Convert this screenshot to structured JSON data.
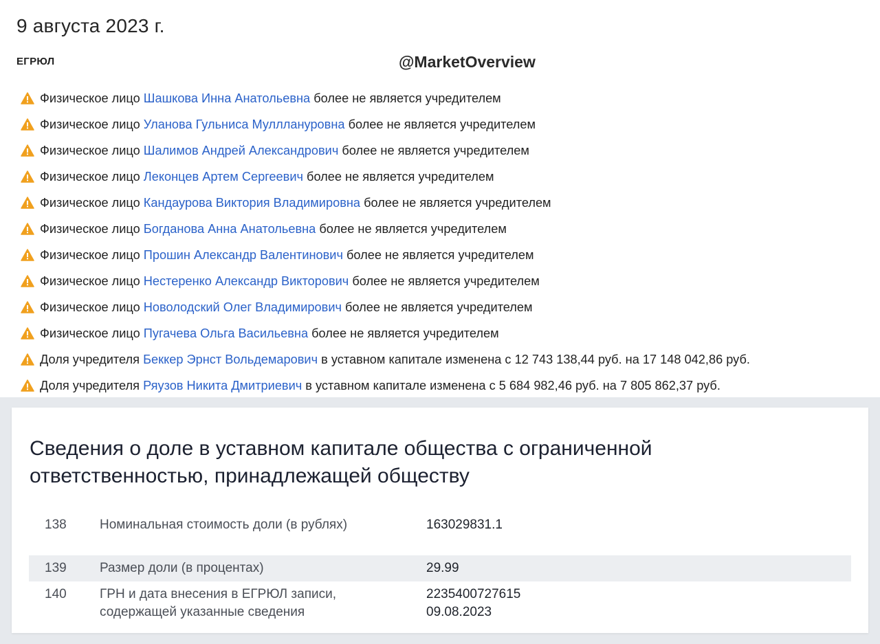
{
  "header": {
    "date": "9 августа 2023 г.",
    "section_label": "ЕГРЮЛ",
    "watermark": "@MarketOverview"
  },
  "events": [
    {
      "prefix": "Физическое лицо",
      "name": "Шашкова Инна Анатольевна",
      "suffix": "более не является учредителем"
    },
    {
      "prefix": "Физическое лицо",
      "name": "Уланова Гульниса Мулллануровна",
      "suffix": "более не является учредителем"
    },
    {
      "prefix": "Физическое лицо",
      "name": "Шалимов Андрей Александрович",
      "suffix": "более не является учредителем"
    },
    {
      "prefix": "Физическое лицо",
      "name": "Леконцев Артем Сергеевич",
      "suffix": "более не является учредителем"
    },
    {
      "prefix": "Физическое лицо",
      "name": "Кандаурова Виктория Владимировна",
      "suffix": "более не является учредителем"
    },
    {
      "prefix": "Физическое лицо",
      "name": "Богданова Анна Анатольевна",
      "suffix": "более не является учредителем"
    },
    {
      "prefix": "Физическое лицо",
      "name": "Прошин Александр Валентинович",
      "suffix": "более не является учредителем"
    },
    {
      "prefix": "Физическое лицо",
      "name": "Нестеренко Александр Викторович",
      "suffix": "более не является учредителем"
    },
    {
      "prefix": "Физическое лицо",
      "name": "Новолодский Олег Владимирович",
      "suffix": "более не является учредителем"
    },
    {
      "prefix": "Физическое лицо",
      "name": "Пугачева Ольга Васильевна",
      "suffix": "более не является учредителем"
    },
    {
      "prefix": "Доля учредителя",
      "name": "Беккер Эрнст Вольдемарович",
      "suffix": "в уставном капитале изменена с 12 743 138,44 руб. на 17 148 042,86 руб."
    },
    {
      "prefix": "Доля учредителя",
      "name": "Ряузов Никита Дмитриевич",
      "suffix": "в уставном капитале изменена с 5 684 982,46 руб. на 7 805 862,37 руб."
    }
  ],
  "card": {
    "title": "Сведения о доле в уставном капитале общества с ограниченной ответственностью, принадлежащей обществу",
    "rows": [
      {
        "num": "138",
        "name": "Номинальная стоимость доли (в рублях)",
        "value_lines": [
          "163029831.1"
        ]
      },
      {
        "num": "139",
        "name": "Размер доли (в процентах)",
        "value_lines": [
          "29.99"
        ]
      },
      {
        "num": "140",
        "name": "ГРН и дата внесения в ЕГРЮЛ записи, содержащей указанные сведения",
        "value_lines": [
          "2235400727615",
          "09.08.2023"
        ]
      }
    ]
  },
  "colors": {
    "link": "#2b62c9",
    "warning": "#f0a01e",
    "background_panel": "#e6e9ed",
    "highlight_row": "#eceef1"
  },
  "icons": {
    "event_icon": "warning-icon"
  }
}
